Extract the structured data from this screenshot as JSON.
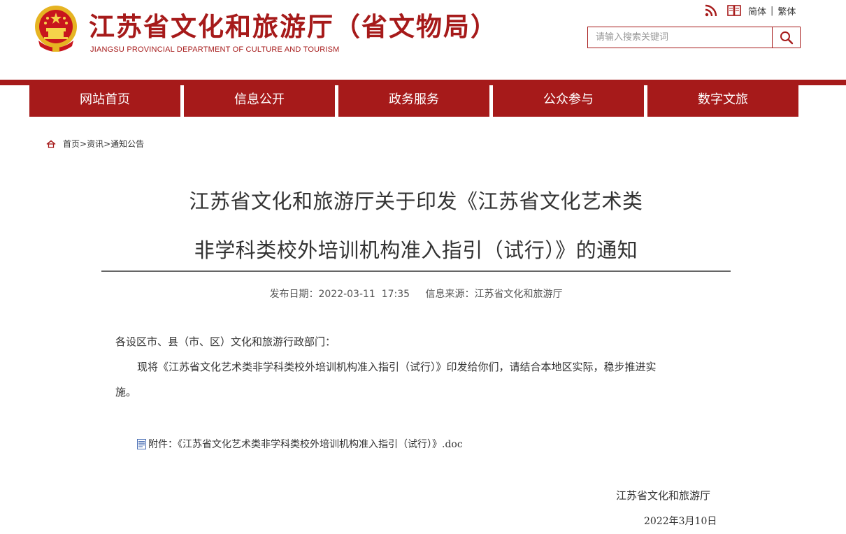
{
  "header": {
    "title": "江苏省文化和旅游厅（省文物局）",
    "subtitle": "JIANGSU PROVINCIAL DEPARTMENT OF CULTURE AND TOURISM",
    "lang_simplified": "简体",
    "lang_separator": "|",
    "lang_traditional": "繁体",
    "search_placeholder": "请输入搜索关键词"
  },
  "nav": {
    "items": [
      "网站首页",
      "信息公开",
      "政务服务",
      "公众参与",
      "数字文旅"
    ]
  },
  "breadcrumb": {
    "home": "首页",
    "sep": ">",
    "level2": "资讯",
    "level3": "通知公告"
  },
  "article": {
    "title_line1": "江苏省文化和旅游厅关于印发《江苏省文化艺术类",
    "title_line2": "非学科类校外培训机构准入指引（试行）》的通知",
    "publish_date": "发布日期：2022-03-11  17:35",
    "source": "信息来源：江苏省文化和旅游厅",
    "greeting": "各设区市、县（市、区）文化和旅游行政部门：",
    "body_line1": "现将《江苏省文化艺术类非学科类校外培训机构准入指引（试行）》印发给你们，请结合本地区实际，稳步推进实",
    "body_line2": "施。",
    "attachment": "附件：《江苏省文化艺术类非学科类校外培训机构准入指引（试行）》.doc",
    "sign_org": "江苏省文化和旅游厅",
    "sign_date": "2022年3月10日"
  },
  "colors": {
    "brand_red": "#a61a1a",
    "text": "#333333",
    "emblem_gold": "#e6b422"
  },
  "icons": [
    "national-emblem-icon",
    "rss-icon",
    "book-icon",
    "search-icon",
    "home-icon",
    "doc-icon"
  ]
}
